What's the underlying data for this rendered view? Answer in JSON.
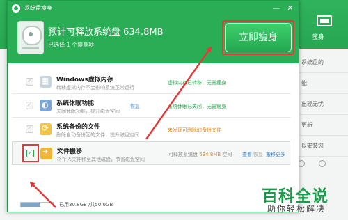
{
  "window": {
    "title": "系统盘瘦身",
    "min_label": "—",
    "close_label": "✕"
  },
  "banner": {
    "title": "预计可释放系统盘 634.8MB",
    "subtitle": "已选择 1 个瘦身项",
    "primary_button": "立即瘦身"
  },
  "items": [
    {
      "title": "Windows虚拟内存",
      "description": "转移虚拟内存不会影响系统正常运行",
      "restore": "",
      "status": "虚拟内存已转移，无需瘦身",
      "checked": false,
      "icon": "windows-icon"
    },
    {
      "title": "系统休眠功能",
      "description": "关闭休眠功能，提升磁盘空间",
      "restore": "恢复",
      "status": "系统休眠已关闭，无需瘦身",
      "checked": false,
      "icon": "sleep-icon"
    },
    {
      "title": "系统备份的文件",
      "description": "删除自动备份区的文件，提升磁盘空间",
      "restore": "",
      "status": "未发现可删除的备份文件",
      "checked": false,
      "icon": "backup-icon"
    },
    {
      "title": "文件搬移",
      "description": "将个人文件移至其他磁盘，节省磁盘空间",
      "restore": "",
      "status_prefix": "可释放系统盘",
      "status_value": "634.8MB",
      "status_suffix": "空间",
      "link_view": "查看",
      "link_restore": "恢复",
      "link_more": "搬移更多",
      "checked": true,
      "icon": "move-file-icon"
    }
  ],
  "footer": {
    "usage_text": "已用30.8GB /共50.0GB",
    "usage_fraction": 0.616
  },
  "background": {
    "side_label": "瘦身",
    "list_items": [
      "系统盘的",
      "",
      "能",
      "",
      "出现无忧",
      "",
      "更新",
      "",
      "以安装您",
      ""
    ]
  },
  "watermark": {
    "line1": "百科全说",
    "line2": "助你轻松解决"
  },
  "colors": {
    "accent_green": "#2aae55",
    "highlight_red": "#e23a3a",
    "link_blue": "#3a84d6"
  }
}
